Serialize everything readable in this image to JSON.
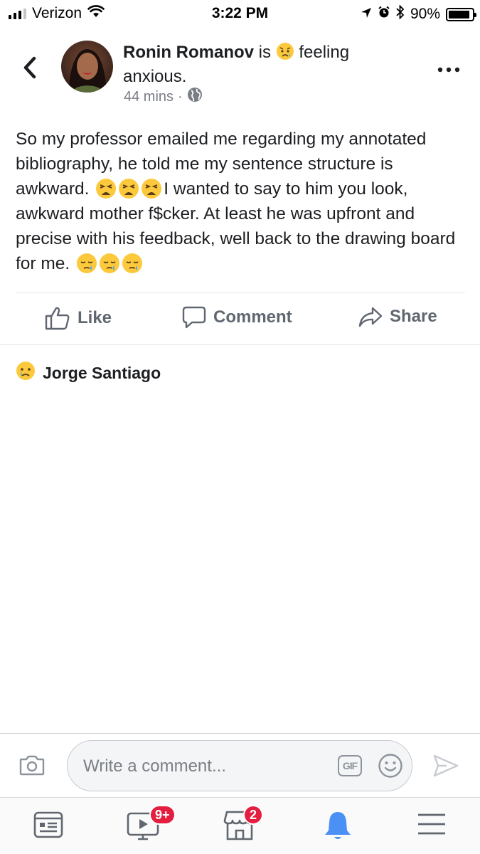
{
  "status_bar": {
    "carrier": "Verizon",
    "time": "3:22 PM",
    "battery": "90%",
    "battery_level": 0.9
  },
  "post": {
    "author": "Ronin Romanov",
    "is_word": "is",
    "feeling_prefix": "feeling",
    "feeling": "anxious.",
    "time_ago": "44 mins",
    "separator": "·",
    "body_part1": "So my professor emailed me regarding my annotated bibliography, he told me my sentence structure is awkward.",
    "body_part2": "I wanted to say to him you look, awkward mother f$cker. At least he was upfront and precise with his feedback, well back to the drawing board for me."
  },
  "actions": {
    "like": "Like",
    "comment": "Comment",
    "share": "Share"
  },
  "reaction": {
    "reactor_name": "Jorge Santiago",
    "icon": "sad-face-icon"
  },
  "comment_bar": {
    "placeholder": "Write a comment...",
    "gif_label": "GIF"
  },
  "tabbar": {
    "watch_badge": "9+",
    "marketplace_badge": "2"
  },
  "colors": {
    "text": "#1c1e21",
    "muted": "#606770",
    "badge": "#e41e3f",
    "active_tab": "#4a90f5"
  }
}
